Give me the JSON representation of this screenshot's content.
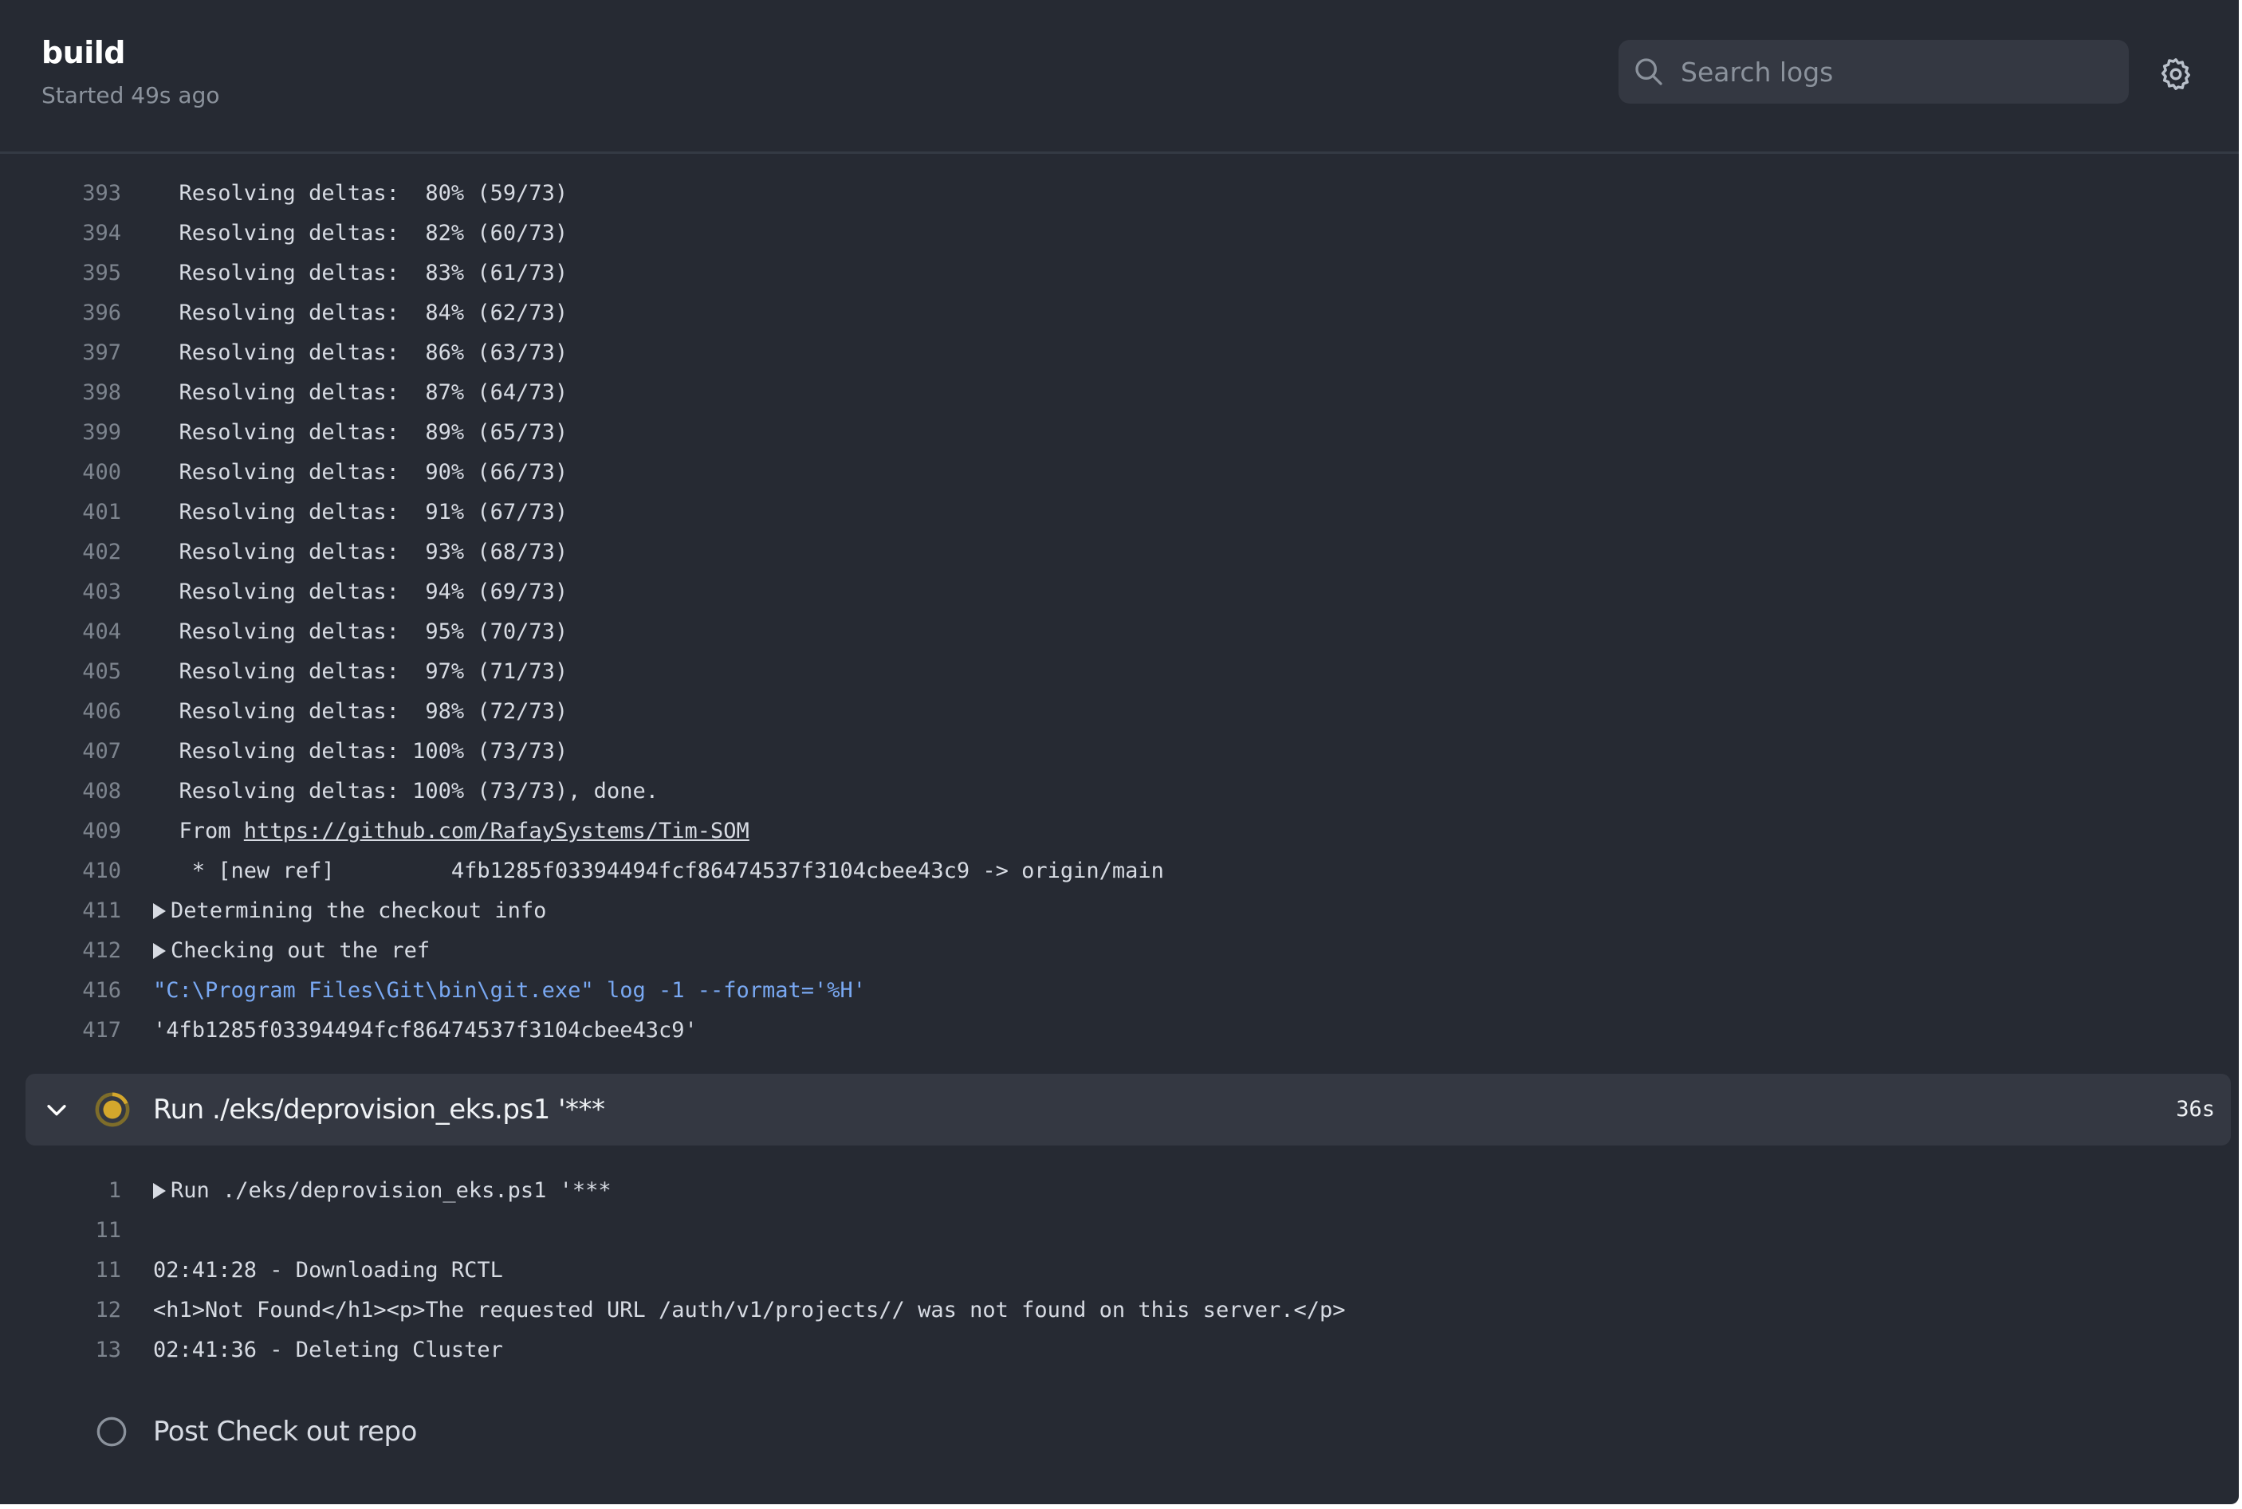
{
  "header": {
    "title": "build",
    "subtitle": "Started 49s ago",
    "search_placeholder": "Search logs",
    "search_value": ""
  },
  "icons": {
    "search": "search-icon",
    "settings": "gear-icon",
    "expand": "chevron-down-icon",
    "in_progress": "in-progress-icon",
    "pending": "pending-circle-icon",
    "group": "triangle-right-icon"
  },
  "colors": {
    "background": "#262a33",
    "step_header_bg": "#343842",
    "in_progress": "#d4a72c",
    "command_text": "#79a8f2",
    "line_number": "#7d848e"
  },
  "log_previous_step": [
    {
      "n": "393",
      "text": "  Resolving deltas:  80% (59/73)"
    },
    {
      "n": "394",
      "text": "  Resolving deltas:  82% (60/73)"
    },
    {
      "n": "395",
      "text": "  Resolving deltas:  83% (61/73)"
    },
    {
      "n": "396",
      "text": "  Resolving deltas:  84% (62/73)"
    },
    {
      "n": "397",
      "text": "  Resolving deltas:  86% (63/73)"
    },
    {
      "n": "398",
      "text": "  Resolving deltas:  87% (64/73)"
    },
    {
      "n": "399",
      "text": "  Resolving deltas:  89% (65/73)"
    },
    {
      "n": "400",
      "text": "  Resolving deltas:  90% (66/73)"
    },
    {
      "n": "401",
      "text": "  Resolving deltas:  91% (67/73)"
    },
    {
      "n": "402",
      "text": "  Resolving deltas:  93% (68/73)"
    },
    {
      "n": "403",
      "text": "  Resolving deltas:  94% (69/73)"
    },
    {
      "n": "404",
      "text": "  Resolving deltas:  95% (70/73)"
    },
    {
      "n": "405",
      "text": "  Resolving deltas:  97% (71/73)"
    },
    {
      "n": "406",
      "text": "  Resolving deltas:  98% (72/73)"
    },
    {
      "n": "407",
      "text": "  Resolving deltas: 100% (73/73)"
    },
    {
      "n": "408",
      "text": "  Resolving deltas: 100% (73/73), done."
    },
    {
      "n": "409",
      "prefix": "  From ",
      "link": "https://github.com/RafaySystems/Tim-SOM"
    },
    {
      "n": "410",
      "text": "   * [new ref]         4fb1285f03394494fcf86474537f3104cbee43c9 -> origin/main"
    },
    {
      "n": "411",
      "group": "Determining the checkout info"
    },
    {
      "n": "412",
      "group": "Checking out the ref"
    },
    {
      "n": "416",
      "command": "\"C:\\Program Files\\Git\\bin\\git.exe\" log -1 --format='%H'"
    },
    {
      "n": "417",
      "text": "'4fb1285f03394494fcf86474537f3104cbee43c9'"
    }
  ],
  "current_step": {
    "title": "Run ./eks/deprovision_eks.ps1 '***",
    "duration": "36s",
    "status": "in_progress",
    "expanded": true,
    "lines": [
      {
        "n": "1",
        "group": "Run ./eks/deprovision_eks.ps1 '***"
      },
      {
        "n": "11",
        "text": ""
      },
      {
        "n": "11",
        "text": "02:41:28 - Downloading RCTL"
      },
      {
        "n": "12",
        "text": "<h1>Not Found</h1><p>The requested URL /auth/v1/projects// was not found on this server.</p>"
      },
      {
        "n": "13",
        "text": "02:41:36 - Deleting Cluster"
      }
    ]
  },
  "next_step": {
    "title": "Post Check out repo",
    "status": "pending"
  }
}
